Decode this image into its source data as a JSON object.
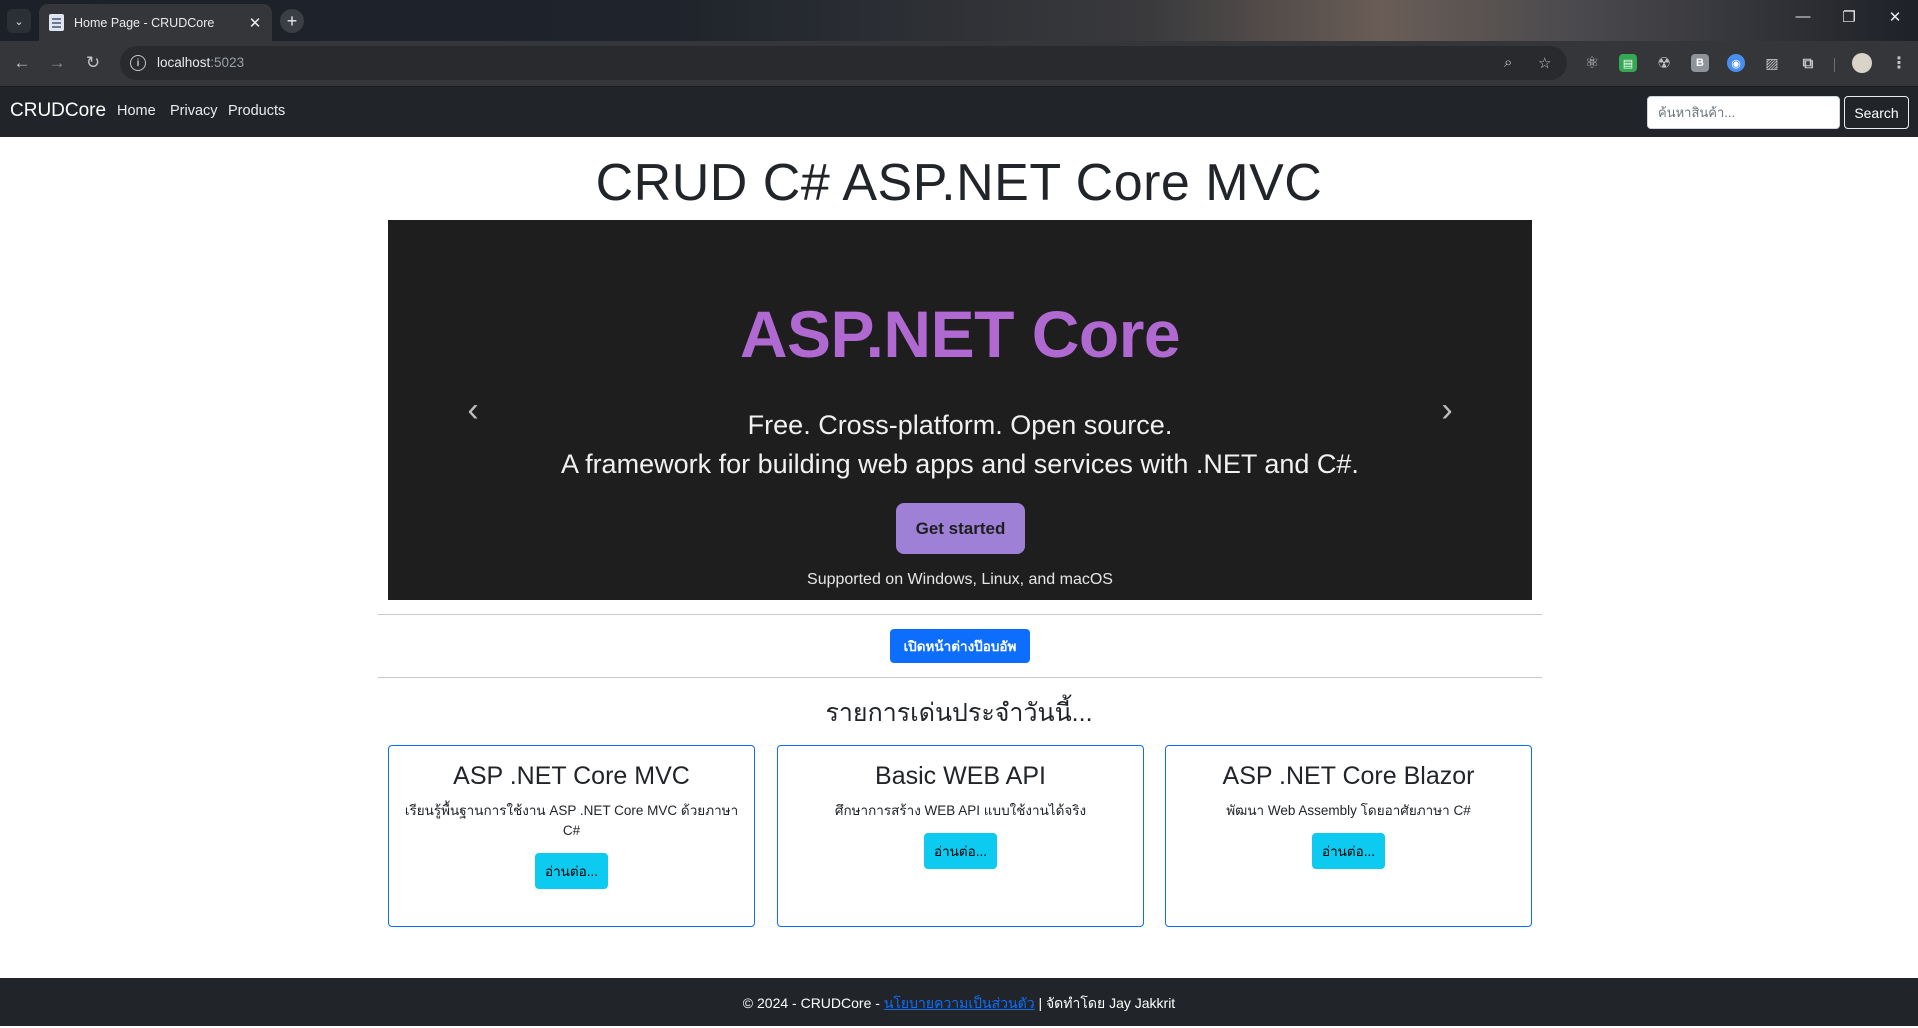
{
  "browser": {
    "tab_title": "Home Page - CRUDCore",
    "url_host": "localhost",
    "url_port": ":5023"
  },
  "navbar": {
    "brand": "CRUDCore",
    "links": [
      "Home",
      "Privacy",
      "Products"
    ],
    "search_placeholder": "ค้นหาสินค้า...",
    "search_button": "Search"
  },
  "main": {
    "title": "CRUD C# ASP.NET Core MVC",
    "carousel": {
      "logo_text": "ASP.NET Core",
      "tagline_1": "Free. Cross-platform. Open source.",
      "tagline_2": "A framework for building web apps and services with .NET and C#.",
      "cta": "Get started",
      "support": "Supported on Windows, Linux, and macOS"
    },
    "popup_button": "เปิดหน้าต่างป๊อบอัพ",
    "section_title": "รายการเด่นประจำวันนี้...",
    "cards": [
      {
        "title": "ASP .NET Core MVC",
        "text": "เรียนรู้พื้นฐานการใช้งาน ASP .NET Core MVC ด้วยภาษา C#",
        "button": "อ่านต่อ..."
      },
      {
        "title": "Basic WEB API",
        "text": "ศึกษาการสร้าง WEB API แบบใช้งานได้จริง",
        "button": "อ่านต่อ..."
      },
      {
        "title": "ASP .NET Core Blazor",
        "text": "พัฒนา Web Assembly โดยอาศัยภาษา C#",
        "button": "อ่านต่อ..."
      }
    ]
  },
  "footer": {
    "copyright": "© 2024 - CRUDCore - ",
    "privacy_link": "นโยบายความเป็นส่วนตัว",
    "credit": " | จัดทำโดย Jay Jakkrit"
  },
  "colors": {
    "navbar_bg": "#212529",
    "primary": "#0d6efd",
    "info": "#0dcaf0",
    "carousel_bg": "#1f1e1f",
    "aspnet_purple": "#b069d1",
    "cta_purple": "#9e81d6"
  }
}
